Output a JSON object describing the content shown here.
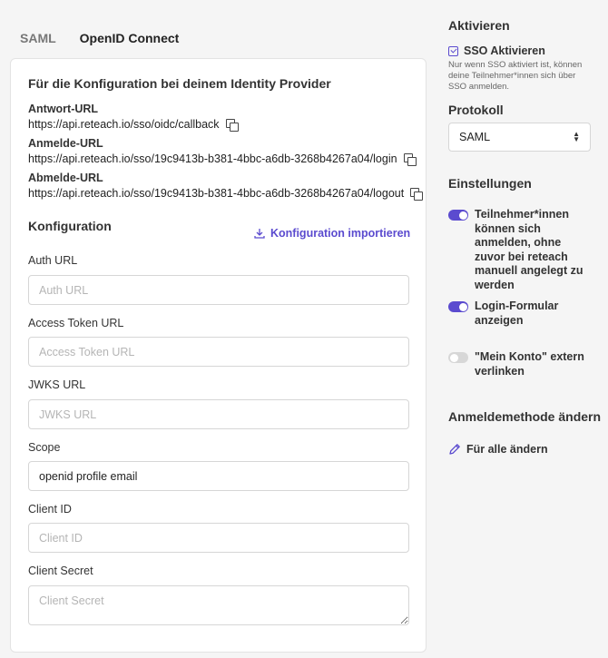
{
  "tabs": [
    {
      "label": "SAML"
    },
    {
      "label": "OpenID Connect"
    }
  ],
  "idp": {
    "heading": "Für die Konfiguration bei deinem Identity Provider",
    "urls": [
      {
        "label": "Antwort-URL",
        "value": "https://api.reteach.io/sso/oidc/callback"
      },
      {
        "label": "Anmelde-URL",
        "value": "https://api.reteach.io/sso/19c9413b-b381-4bbc-a6db-3268b4267a04/login"
      },
      {
        "label": "Abmelde-URL",
        "value": "https://api.reteach.io/sso/19c9413b-b381-4bbc-a6db-3268b4267a04/logout"
      }
    ]
  },
  "konfiguration": {
    "heading": "Konfiguration",
    "import_label": "Konfiguration importieren",
    "fields": [
      {
        "label": "Auth URL",
        "placeholder": "Auth URL",
        "value": ""
      },
      {
        "label": "Access Token URL",
        "placeholder": "Access Token URL",
        "value": ""
      },
      {
        "label": "JWKS URL",
        "placeholder": "JWKS URL",
        "value": ""
      },
      {
        "label": "Scope",
        "placeholder": "",
        "value": "openid profile email"
      },
      {
        "label": "Client ID",
        "placeholder": "Client ID",
        "value": ""
      },
      {
        "label": "Client Secret",
        "placeholder": "Client Secret",
        "value": ""
      }
    ]
  },
  "sidebar": {
    "aktivieren": {
      "heading": "Aktivieren",
      "checkbox_label": "SSO Aktivieren",
      "checked": true,
      "note": "Nur wenn SSO aktiviert ist, können deine Teilnehmer*innen sich über SSO anmelden."
    },
    "protokoll": {
      "heading": "Protokoll",
      "selected": "SAML"
    },
    "einstellungen": {
      "heading": "Einstellungen",
      "toggles": [
        {
          "label": "Teilnehmer*innen können sich anmelden, ohne zuvor bei reteach manuell angelegt zu werden",
          "on": true
        },
        {
          "label": "Login-Formular anzeigen",
          "on": true
        },
        {
          "label": "\"Mein Konto\" extern verlinken",
          "on": false
        }
      ]
    },
    "anmeldemethode": {
      "heading": "Anmeldemethode ändern",
      "action_label": "Für alle ändern"
    }
  },
  "colors": {
    "accent": "#5b4bcf",
    "background": "#f5f5f5",
    "card": "#ffffff"
  }
}
